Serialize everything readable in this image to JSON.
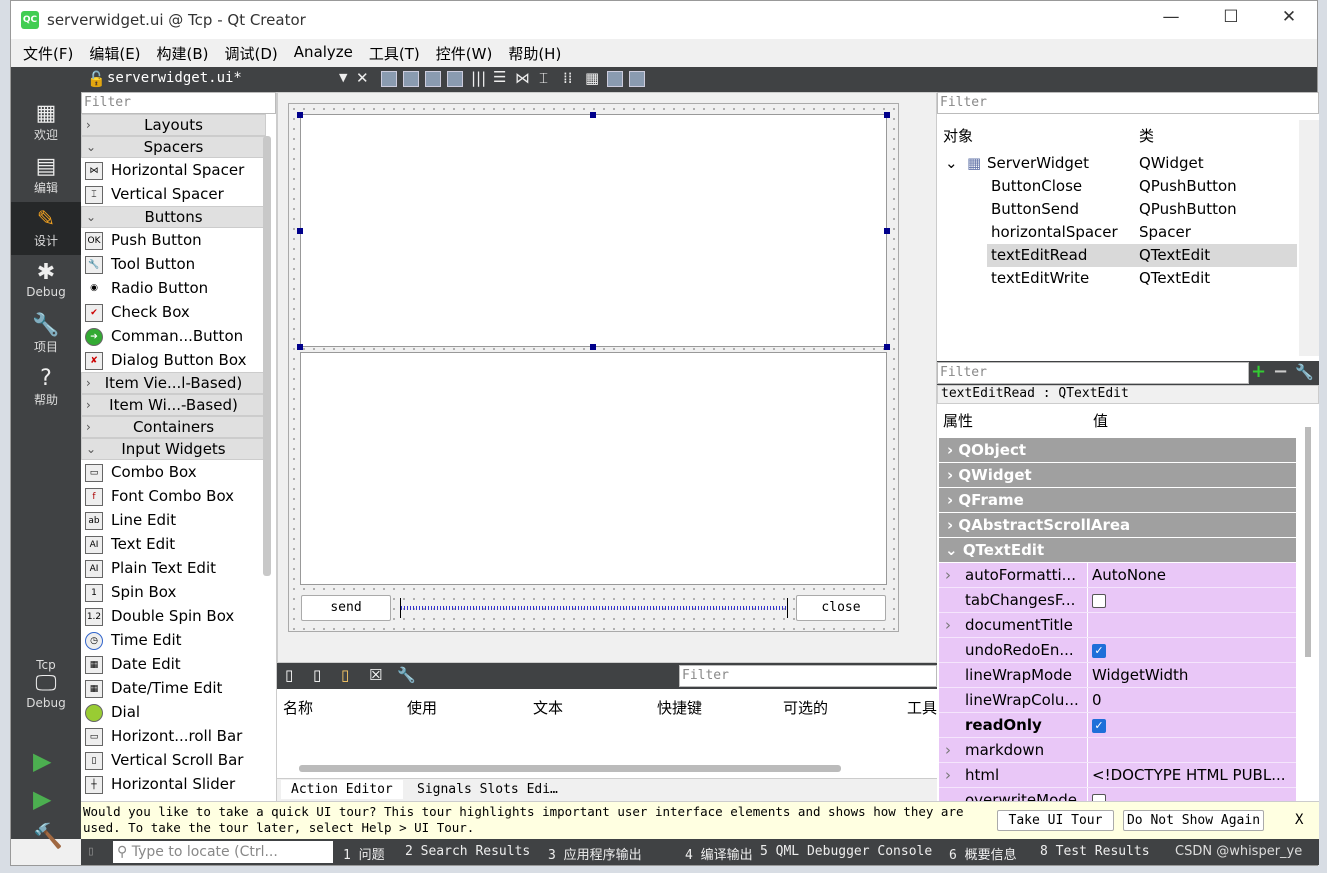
{
  "window": {
    "title": "serverwidget.ui @ Tcp - Qt Creator",
    "app_icon": "QC"
  },
  "menu": [
    "文件(F)",
    "编辑(E)",
    "构建(B)",
    "调试(D)",
    "Analyze",
    "工具(T)",
    "控件(W)",
    "帮助(H)"
  ],
  "toolbar": {
    "file_tab": "serverwidget.ui*"
  },
  "modes": [
    {
      "label": "欢迎",
      "icon": "grid-icon"
    },
    {
      "label": "编辑",
      "icon": "document-icon"
    },
    {
      "label": "设计",
      "icon": "pencil-icon"
    },
    {
      "label": "Debug",
      "icon": "bug-icon"
    },
    {
      "label": "项目",
      "icon": "wrench-icon"
    },
    {
      "label": "帮助",
      "icon": "help-icon"
    }
  ],
  "kit": {
    "project": "Tcp",
    "config": "Debug"
  },
  "widget_box": {
    "filter_placeholder": "Filter",
    "categories": {
      "layouts": "Layouts",
      "spacers": "Spacers",
      "buttons": "Buttons",
      "item_views": "Item Vie...l-Based)",
      "item_widgets": "Item Wi...-Based)",
      "containers": "Containers",
      "input": "Input Widgets"
    },
    "spacers": [
      "Horizontal Spacer",
      "Vertical Spacer"
    ],
    "buttons": [
      "Push Button",
      "Tool Button",
      "Radio Button",
      "Check Box",
      "Comman...Button",
      "Dialog Button Box"
    ],
    "inputs": [
      "Combo Box",
      "Font Combo Box",
      "Line Edit",
      "Text Edit",
      "Plain Text Edit",
      "Spin Box",
      "Double Spin Box",
      "Time Edit",
      "Date Edit",
      "Date/Time Edit",
      "Dial",
      "Horizont...roll Bar",
      "Vertical Scroll Bar",
      "Horizontal Slider"
    ]
  },
  "form": {
    "send": "send",
    "close": "close"
  },
  "action_editor": {
    "filter_placeholder": "Filter",
    "columns": [
      "名称",
      "使用",
      "文本",
      "快捷键",
      "可选的",
      "工具"
    ],
    "tabs": [
      "Action Editor",
      "Signals  Slots Edi…"
    ]
  },
  "object_inspector": {
    "filter_placeholder": "Filter",
    "headers": [
      "对象",
      "类"
    ],
    "root": {
      "name": "ServerWidget",
      "class": "QWidget"
    },
    "children": [
      {
        "name": "ButtonClose",
        "class": "QPushButton"
      },
      {
        "name": "ButtonSend",
        "class": "QPushButton"
      },
      {
        "name": "horizontalSpacer",
        "class": "Spacer"
      },
      {
        "name": "textEditRead",
        "class": "QTextEdit",
        "selected": true
      },
      {
        "name": "textEditWrite",
        "class": "QTextEdit"
      }
    ]
  },
  "property_editor": {
    "filter_placeholder": "Filter",
    "current": "textEditRead : QTextEdit",
    "headers": [
      "属性",
      "值"
    ],
    "groups": [
      "QObject",
      "QWidget",
      "QFrame",
      "QAbstractScrollArea",
      "QTextEdit"
    ],
    "props": [
      {
        "name": "autoFormatti...",
        "value": "AutoNone",
        "expand": true
      },
      {
        "name": "tabChangesF...",
        "check": false
      },
      {
        "name": "documentTitle",
        "value": "",
        "expand": true
      },
      {
        "name": "undoRedoEn...",
        "check": true
      },
      {
        "name": "lineWrapMode",
        "value": "WidgetWidth"
      },
      {
        "name": "lineWrapColu...",
        "value": "0"
      },
      {
        "name": "readOnly",
        "check": true,
        "bold": true
      },
      {
        "name": "markdown",
        "value": "",
        "expand": true
      },
      {
        "name": "html",
        "value": "<!DOCTYPE HTML PUBL...",
        "expand": true
      },
      {
        "name": "overwriteMode",
        "check": false
      }
    ]
  },
  "tour": {
    "message": "Would you like to take a quick UI tour? This tour highlights important user interface elements and shows how they are used. To take the tour later, select Help > UI Tour.",
    "take": "Take UI Tour",
    "dont": "Do Not Show Again",
    "close": "X"
  },
  "status": {
    "locate_placeholder": "Type to locate (Ctrl...",
    "panes": [
      "1 问题",
      "2 Search Results",
      "3 应用程序输出",
      "4 编译输出",
      "5 QML Debugger Console",
      "6 概要信息",
      "8 Test Results"
    ],
    "watermark": "CSDN @whisper_ye"
  }
}
